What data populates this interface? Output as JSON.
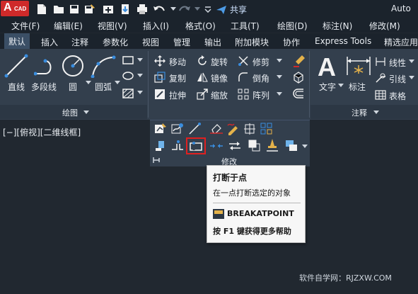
{
  "quick_access": {
    "logo_letter": "A",
    "logo_sub": "CAD",
    "share_label": "共享",
    "app_title": "Auto"
  },
  "menu": [
    "文件(F)",
    "编辑(E)",
    "视图(V)",
    "插入(I)",
    "格式(O)",
    "工具(T)",
    "绘图(D)",
    "标注(N)",
    "修改(M)"
  ],
  "tabs": [
    "默认",
    "插入",
    "注释",
    "参数化",
    "视图",
    "管理",
    "输出",
    "附加模块",
    "协作",
    "Express Tools",
    "精选应用"
  ],
  "active_tab": "默认",
  "draw_panel": {
    "tools": [
      "直线",
      "多段线",
      "圆",
      "圆弧"
    ],
    "title": "绘图"
  },
  "modify_panel": {
    "rows": [
      [
        "移动",
        "旋转",
        "修剪"
      ],
      [
        "复制",
        "镜像",
        "倒角"
      ],
      [
        "拉伸",
        "缩放",
        "阵列"
      ]
    ],
    "title": "修改"
  },
  "annotation_panel": {
    "text_label": "文字",
    "dim_label": "标注",
    "items": [
      "线性",
      "引线",
      "表格"
    ],
    "title": "注释"
  },
  "viewport_label": "[−][俯视][二维线框]",
  "tooltip": {
    "title": "打断于点",
    "description": "在一点打断选定的对象",
    "command": "BREAKATPOINT",
    "help": "按 F1 键获得更多帮助"
  },
  "watermark": "软件自学网：RJZXW.COM",
  "colors": {
    "accent": "#cf2a2a",
    "ribbon_bg": "#333f4d",
    "title_bg": "#1b232c",
    "canvas_bg": "#212830"
  }
}
